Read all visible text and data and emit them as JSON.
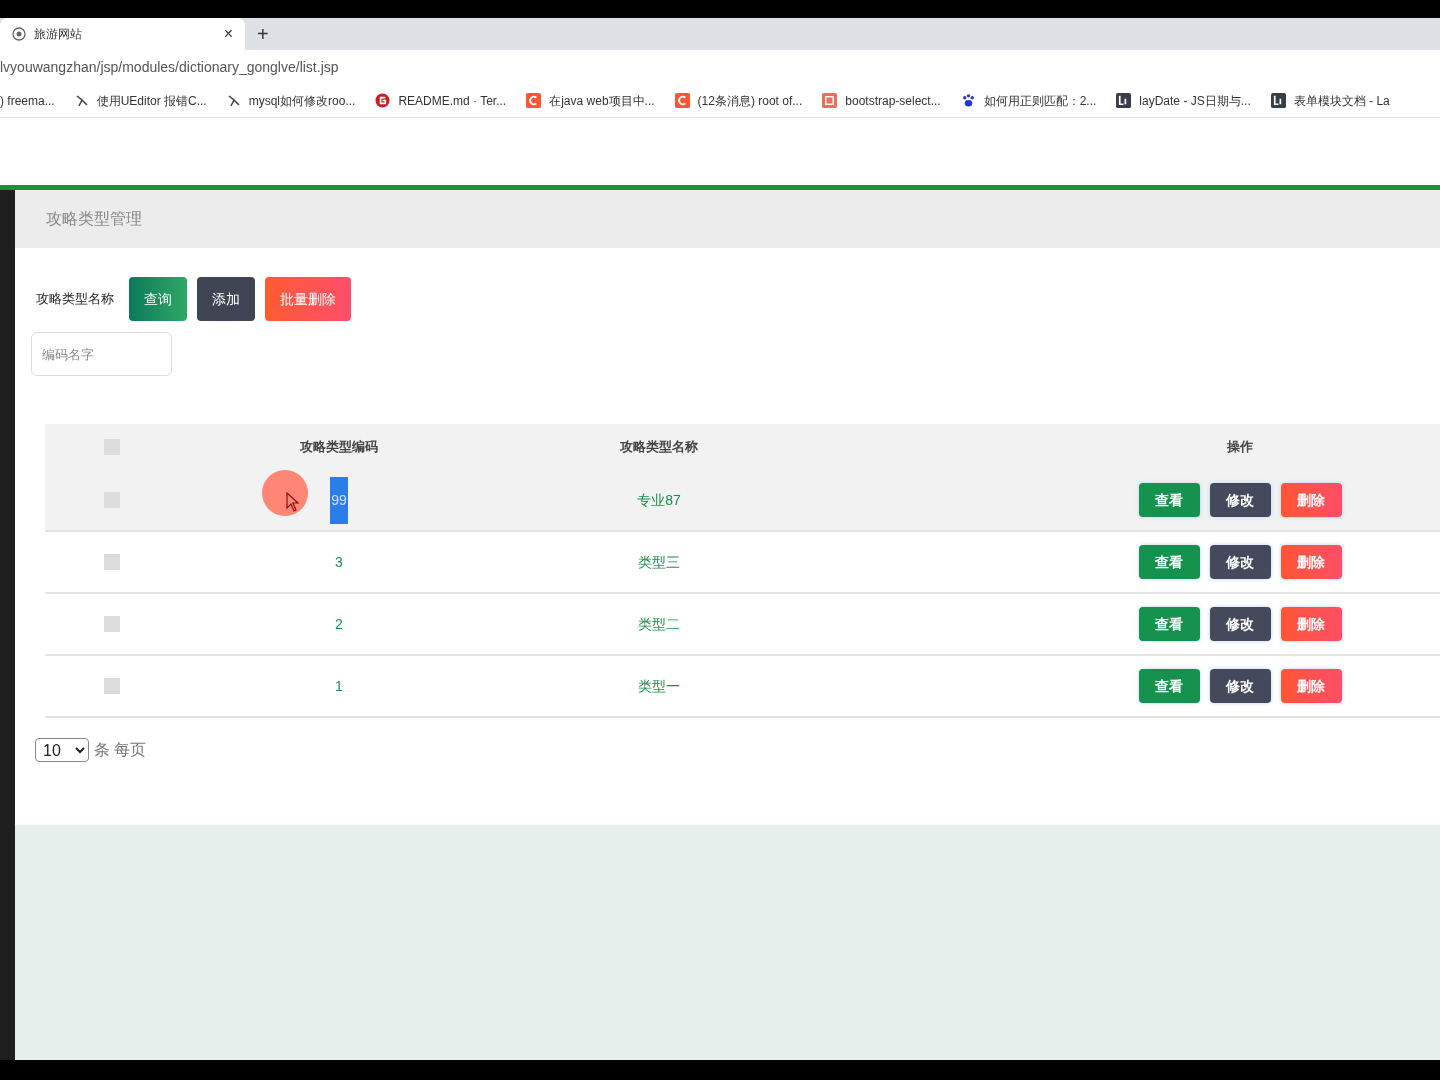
{
  "browser": {
    "tab": {
      "title": "旅游网站",
      "close": "×"
    },
    "new_tab": "+",
    "url": "lvyouwangzhan/jsp/modules/dictionary_gonglve/list.jsp",
    "bookmarks": [
      {
        "label": ") freema...",
        "kind": "none"
      },
      {
        "label": "使用UEditor 报错C...",
        "kind": "lambda"
      },
      {
        "label": "mysql如何修改roo...",
        "kind": "lambda"
      },
      {
        "label": "README.md · Ter...",
        "kind": "gitee"
      },
      {
        "label": "在java web项目中...",
        "kind": "csdn"
      },
      {
        "label": "(12条消息) root of...",
        "kind": "csdn"
      },
      {
        "label": "bootstrap-select...",
        "kind": "jianshu"
      },
      {
        "label": "如何用正则匹配：2...",
        "kind": "paw"
      },
      {
        "label": "layDate - JS日期与...",
        "kind": "layui"
      },
      {
        "label": "表单模块文档 - La",
        "kind": "layui"
      }
    ]
  },
  "page": {
    "title": "攻略类型管理",
    "search": {
      "label": "攻略类型名称",
      "placeholder": "编码名字"
    },
    "buttons": [
      {
        "label": "查询",
        "kind": "query"
      },
      {
        "label": "添加",
        "kind": "add"
      },
      {
        "label": "批量删除",
        "kind": "delete"
      }
    ],
    "table": {
      "header_checked": false,
      "columns": [
        "攻略类型编码",
        "攻略类型名称",
        "操作"
      ],
      "rows": [
        {
          "checked": false,
          "hovered": true,
          "code": "99",
          "code_highlighted": true,
          "name": "专业87",
          "actions": [
            {
              "label": "查看",
              "kind": "view"
            },
            {
              "label": "修改",
              "kind": "edit"
            },
            {
              "label": "删除",
              "kind": "delete"
            }
          ]
        },
        {
          "checked": false,
          "hovered": false,
          "code": "3",
          "code_highlighted": false,
          "name": "类型三",
          "actions": [
            {
              "label": "查看",
              "kind": "view"
            },
            {
              "label": "修改",
              "kind": "edit"
            },
            {
              "label": "删除",
              "kind": "delete"
            }
          ]
        },
        {
          "checked": false,
          "hovered": false,
          "code": "2",
          "code_highlighted": false,
          "name": "类型二",
          "actions": [
            {
              "label": "查看",
              "kind": "view"
            },
            {
              "label": "修改",
              "kind": "edit"
            },
            {
              "label": "删除",
              "kind": "delete"
            }
          ]
        },
        {
          "checked": false,
          "hovered": false,
          "code": "1",
          "code_highlighted": false,
          "name": "类型一",
          "actions": [
            {
              "label": "查看",
              "kind": "view"
            },
            {
              "label": "修改",
              "kind": "edit"
            },
            {
              "label": "删除",
              "kind": "delete"
            }
          ]
        }
      ]
    },
    "page_size": {
      "value": "10",
      "label": "条 每页"
    }
  }
}
